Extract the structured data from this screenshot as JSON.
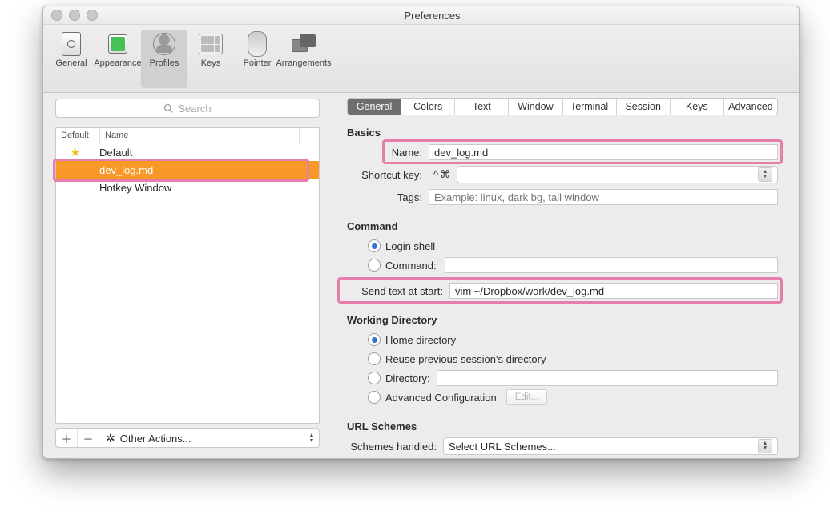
{
  "window": {
    "title": "Preferences"
  },
  "toolbar": {
    "items": [
      {
        "label": "General"
      },
      {
        "label": "Appearance"
      },
      {
        "label": "Profiles"
      },
      {
        "label": "Keys"
      },
      {
        "label": "Pointer"
      },
      {
        "label": "Arrangements"
      }
    ]
  },
  "search": {
    "placeholder": "Search"
  },
  "profiles": {
    "cols": {
      "default": "Default",
      "name": "Name"
    },
    "rows": [
      {
        "name": "Default",
        "is_default": true
      },
      {
        "name": "dev_log.md",
        "is_default": false,
        "selected": true
      },
      {
        "name": "Hotkey Window",
        "is_default": false
      }
    ],
    "actions": {
      "add": "＋",
      "remove": "－",
      "other": "Other Actions..."
    }
  },
  "tabs": [
    "General",
    "Colors",
    "Text",
    "Window",
    "Terminal",
    "Session",
    "Keys",
    "Advanced"
  ],
  "sections": {
    "basics": "Basics",
    "command": "Command",
    "workdir": "Working Directory",
    "url": "URL Schemes"
  },
  "basics": {
    "name_label": "Name:",
    "name_value": "dev_log.md",
    "shortcut_label": "Shortcut key:",
    "shortcut_symbols": "^⌘",
    "tags_label": "Tags:",
    "tags_placeholder": "Example: linux, dark bg, tall window"
  },
  "command": {
    "login_shell": "Login shell",
    "command_label": "Command:",
    "command_value": "",
    "send_label": "Send text at start:",
    "send_value": "vim ~/Dropbox/work/dev_log.md"
  },
  "workdir": {
    "home": "Home directory",
    "reuse": "Reuse previous session's directory",
    "dir_label": "Directory:",
    "dir_value": "",
    "advanced": "Advanced Configuration",
    "edit": "Edit..."
  },
  "url": {
    "label": "Schemes handled:",
    "value": "Select URL Schemes..."
  }
}
